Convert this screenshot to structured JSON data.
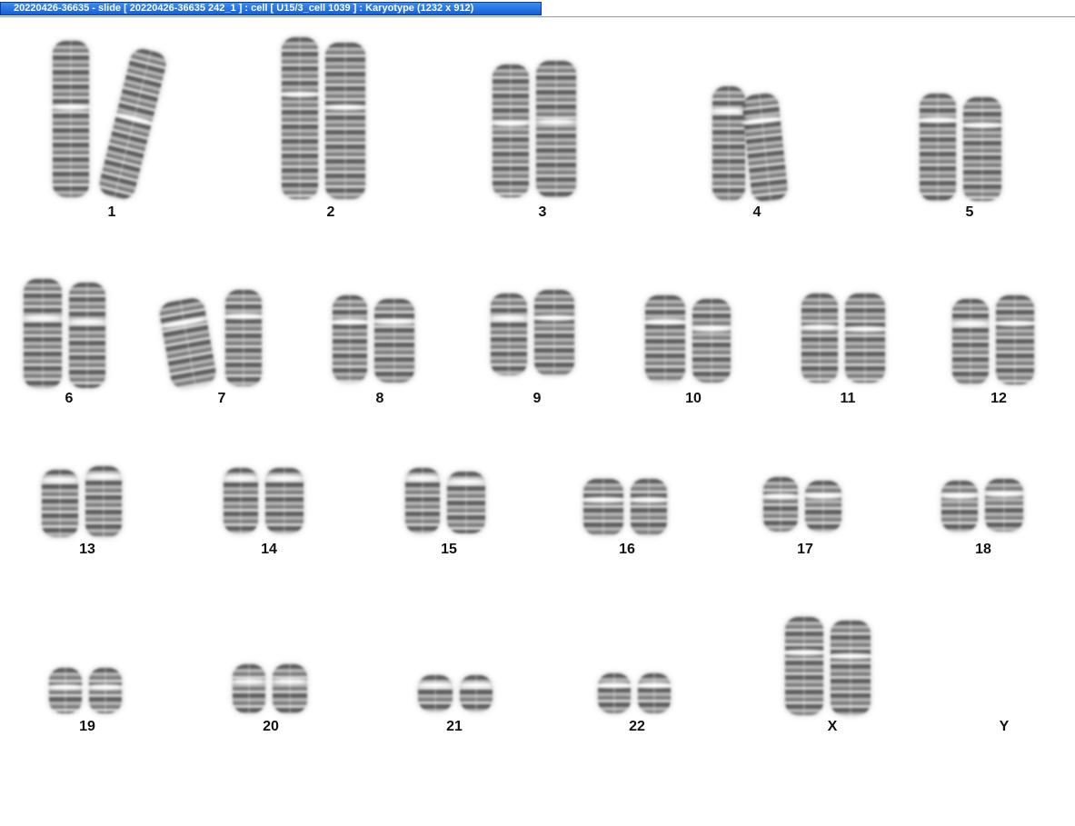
{
  "window": {
    "title": "20220426-36635 - slide [ 20220426-36635 242_1 ] : cell [ U15/3_cell 1039 ] : Karyotype  (1232 x 912)"
  },
  "karyotype": {
    "labels": {
      "c1": "1",
      "c2": "2",
      "c3": "3",
      "c4": "4",
      "c5": "5",
      "c6": "6",
      "c7": "7",
      "c8": "8",
      "c9": "9",
      "c10": "10",
      "c11": "11",
      "c12": "12",
      "c13": "13",
      "c14": "14",
      "c15": "15",
      "c16": "16",
      "c17": "17",
      "c18": "18",
      "c19": "19",
      "c20": "20",
      "c21": "21",
      "c22": "22",
      "cX": "X",
      "cY": "Y"
    }
  }
}
